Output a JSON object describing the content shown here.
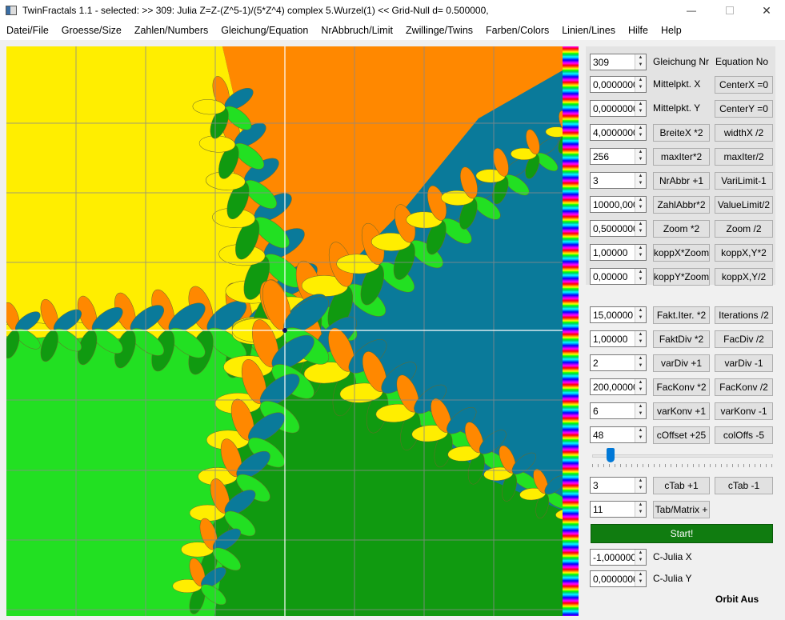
{
  "window": {
    "title": "TwinFractals 1.1 - selected: >> 309: Julia Z=Z-(Z^5-1)/(5*Z^4) complex 5.Wurzel(1) << Grid-Null d= 0.500000,",
    "minimize": "—",
    "close": "✕"
  },
  "menu": [
    "Datei/File",
    "Groesse/Size",
    "Zahlen/Numbers",
    "Gleichung/Equation",
    "NrAbbruch/Limit",
    "Zwillinge/Twins",
    "Farben/Colors",
    "Linien/Lines",
    "Hilfe",
    "Help"
  ],
  "colors": {
    "fractal_yellow": "#ffee00",
    "fractal_orange": "#ff8800",
    "fractal_teal": "#0a7a9a",
    "fractal_light_green": "#22e022",
    "fractal_dark_green": "#109a10",
    "start_button": "#107c10"
  },
  "panel": {
    "equation": {
      "value": "309",
      "label": "Gleichung Nr",
      "label2": "Equation No"
    },
    "centerx": {
      "value": "0,0000000",
      "label": "Mittelpkt. X",
      "button": "CenterX =0"
    },
    "centery": {
      "value": "0,0000000",
      "label": "Mittelpkt. Y",
      "button": "CenterY =0"
    },
    "breite": {
      "value": "4,0000000",
      "button1": "BreiteX *2",
      "button2": "widthX /2"
    },
    "maxiter": {
      "value": "256",
      "button1": "maxIter*2",
      "button2": "maxIter/2"
    },
    "nrabbr": {
      "value": "3",
      "button1": "NrAbbr +1",
      "button2": "VariLimit-1"
    },
    "zahlabbr": {
      "value": "10000,000",
      "button1": "ZahlAbbr*2",
      "button2": "ValueLimit/2"
    },
    "zoom": {
      "value": "0,5000000",
      "button1": "Zoom *2",
      "button2": "Zoom /2"
    },
    "koppx": {
      "value": "1,00000",
      "button1": "koppX*Zoom",
      "button2": "koppX,Y*2"
    },
    "koppy": {
      "value": "0,00000",
      "button1": "koppY*Zoom",
      "button2": "koppX,Y/2"
    },
    "faktiter": {
      "value": "15,00000",
      "button1": "Fakt.Iter. *2",
      "button2": "Iterations /2"
    },
    "faktdiv": {
      "value": "1,00000",
      "button1": "FaktDiv *2",
      "button2": "FacDiv /2"
    },
    "vardiv": {
      "value": "2",
      "button1": "varDiv +1",
      "button2": "varDiv -1"
    },
    "fackonv": {
      "value": "200,00000",
      "button1": "FacKonv *2",
      "button2": "FacKonv /2"
    },
    "varkonv": {
      "value": "6",
      "button1": "varKonv +1",
      "button2": "varKonv -1"
    },
    "coffset": {
      "value": "48",
      "button1": "cOffset +25",
      "button2": "colOffs -5"
    },
    "slider_fraction": 0.1,
    "ctab": {
      "value": "3",
      "button1": "cTab +1",
      "button2": "cTab -1"
    },
    "tabmatrix": {
      "value": "11",
      "button1": "Tab/Matrix +"
    },
    "start": "Start!",
    "cjuliax": {
      "value": "-1,0000000",
      "label": "C-Julia X"
    },
    "cjuliay": {
      "value": "0,0000000",
      "label": "C-Julia Y"
    },
    "orbit": "Orbit Aus"
  }
}
